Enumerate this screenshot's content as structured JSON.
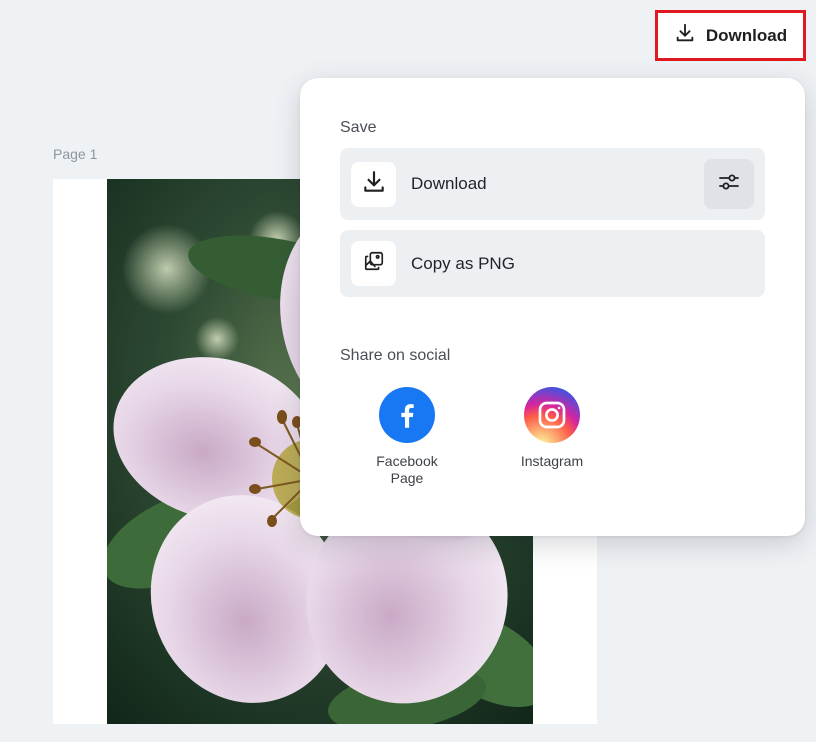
{
  "header": {
    "download_button_label": "Download"
  },
  "canvas": {
    "page_label": "Page 1"
  },
  "popover": {
    "save_section_title": "Save",
    "actions": [
      {
        "label": "Download",
        "icon": "download-icon"
      },
      {
        "label": "Copy as PNG",
        "icon": "copy-image-icon"
      }
    ],
    "share_section_title": "Share on social",
    "social": [
      {
        "label": "Facebook Page",
        "icon": "facebook-icon",
        "color": "#1877f2"
      },
      {
        "label": "Instagram",
        "icon": "instagram-icon",
        "color": "#d6249f"
      }
    ]
  },
  "colors": {
    "highlight_border": "#e0181f",
    "background": "#eff2f5",
    "row_background": "#edf0f3"
  }
}
